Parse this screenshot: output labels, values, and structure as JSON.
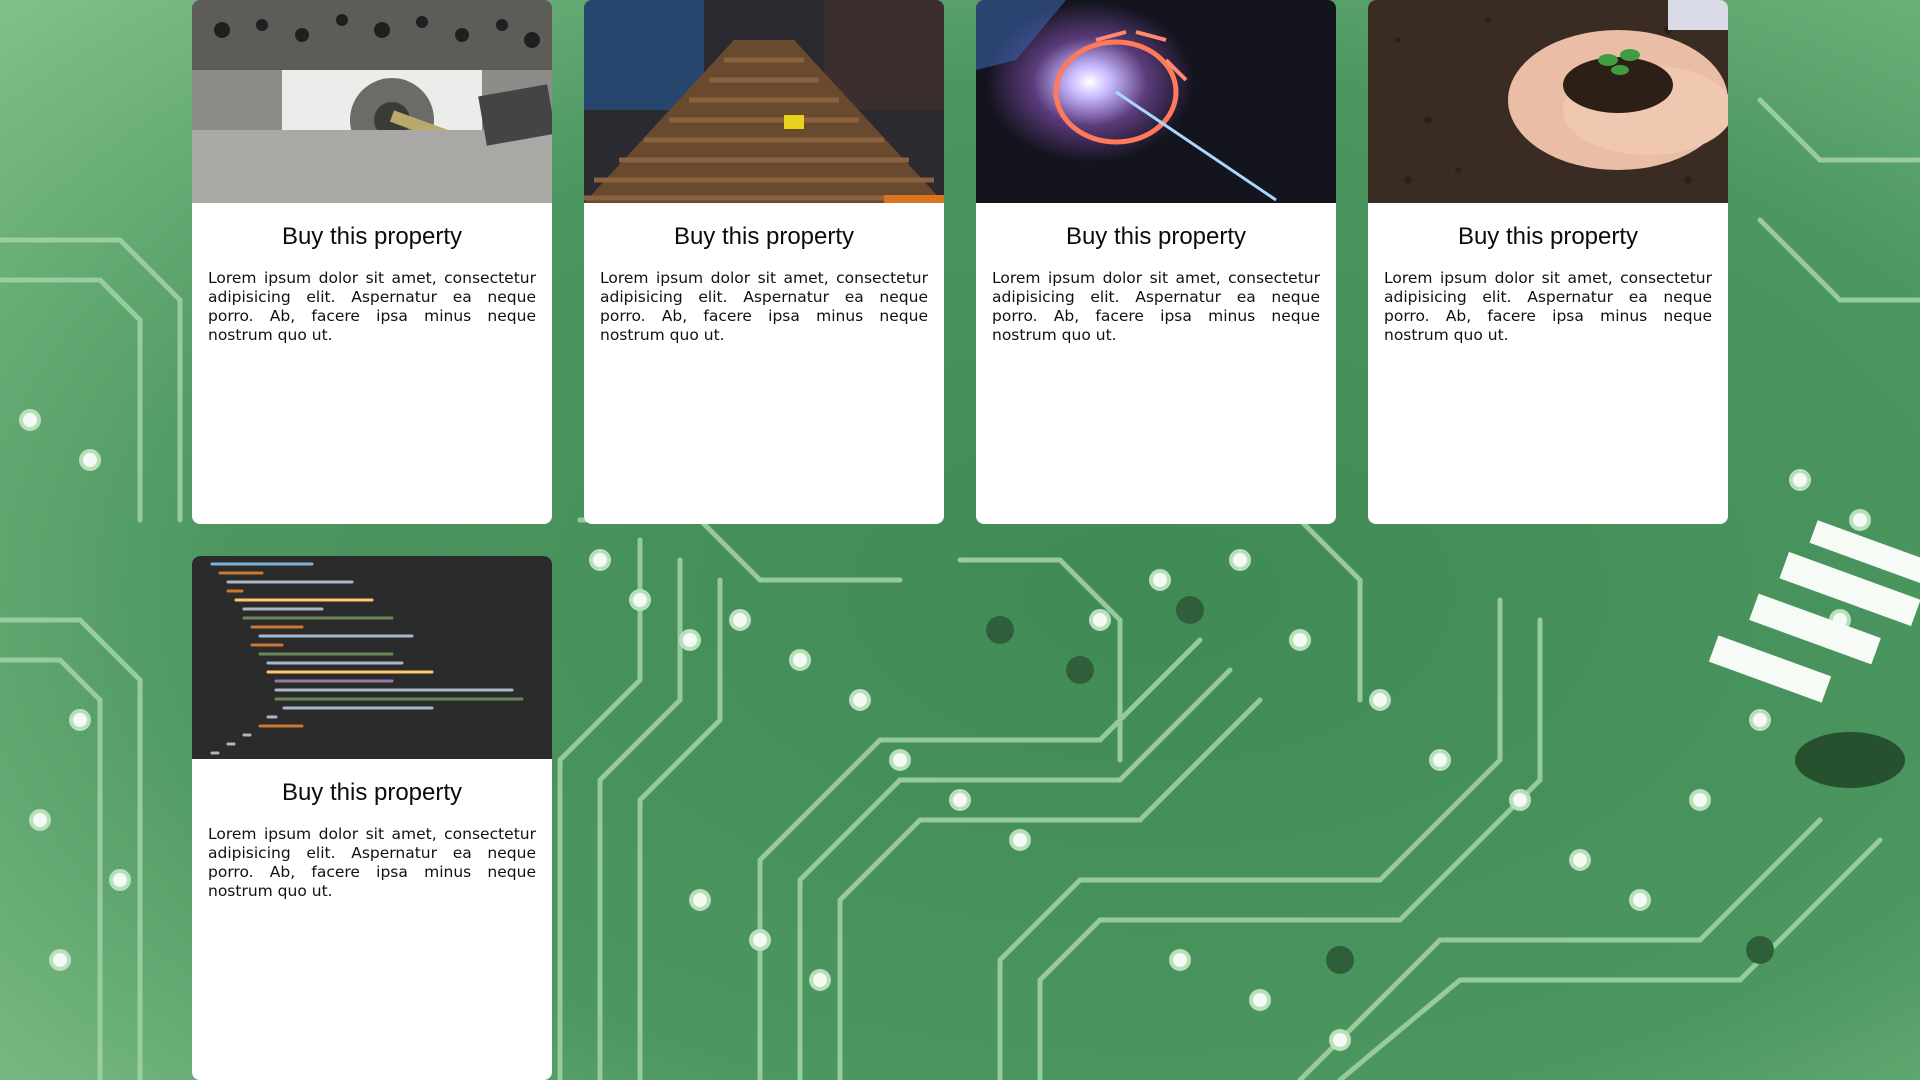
{
  "background": {
    "image": "circuit-board-photo",
    "color": "#4f8f5f"
  },
  "cards": [
    {
      "image": "robotic-gear-machine-photo",
      "title": "Buy this property",
      "text": "Lorem ipsum dolor sit amet, consectetur adipisicing elit. Aspernatur ea neque porro. Ab, facere ipsa minus neque nostrum quo ut."
    },
    {
      "image": "industrial-roller-conveyor-photo",
      "title": "Buy this property",
      "text": "Lorem ipsum dolor sit amet, consectetur adipisicing elit. Aspernatur ea neque porro. Ab, facere ipsa minus neque nostrum quo ut."
    },
    {
      "image": "light-tunnel-photo",
      "title": "Buy this property",
      "text": "Lorem ipsum dolor sit amet, consectetur adipisicing elit. Aspernatur ea neque porro. Ab, facere ipsa minus neque nostrum quo ut."
    },
    {
      "image": "hands-holding-plant-photo",
      "title": "Buy this property",
      "text": "Lorem ipsum dolor sit amet, consectetur adipisicing elit. Aspernatur ea neque porro. Ab, facere ipsa minus neque nostrum quo ut."
    },
    {
      "image": "code-editor-screenshot",
      "title": "Buy this property",
      "text": "Lorem ipsum dolor sit amet, consectetur adipisicing elit. Aspernatur ea neque porro. Ab, facere ipsa minus neque nostrum quo ut."
    }
  ]
}
